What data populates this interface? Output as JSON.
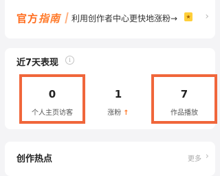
{
  "banner": {
    "brand_part1": "官方",
    "brand_part2": "指南",
    "promo_text": "利用创作者中心更快地涨粉→",
    "emoji_icon": "star-emoji",
    "chevron_icon": "chevron-right"
  },
  "stats": {
    "title": "近7天表现",
    "info_icon": "info",
    "metrics": [
      {
        "value": "0",
        "label": "个人主页访客"
      },
      {
        "value": "1",
        "label": "涨粉",
        "trend_icon": "arrow-up"
      },
      {
        "value": "7",
        "label": "作品播放"
      }
    ]
  },
  "hot": {
    "title": "创作热点",
    "more_label": "更多",
    "chevron_icon": "chevron-right"
  },
  "colors": {
    "accent": "#ff6a1a",
    "highlight_border": "#f0663b"
  }
}
